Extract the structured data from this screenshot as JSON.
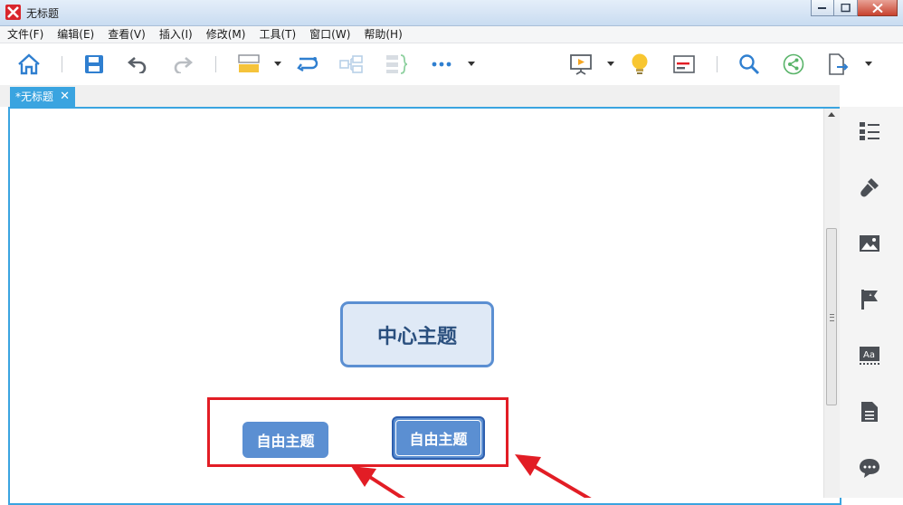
{
  "window": {
    "title": "无标题"
  },
  "menu": [
    {
      "label": "文件(F)"
    },
    {
      "label": "编辑(E)"
    },
    {
      "label": "查看(V)"
    },
    {
      "label": "插入(I)"
    },
    {
      "label": "修改(M)"
    },
    {
      "label": "工具(T)"
    },
    {
      "label": "窗口(W)"
    },
    {
      "label": "帮助(H)"
    }
  ],
  "toolbar": {
    "icons": [
      "home-icon",
      "save-icon",
      "undo-icon",
      "redo-icon",
      "topic-icon",
      "relationship-icon",
      "summary-icon",
      "boundary-icon",
      "more-icon",
      "presentation-icon",
      "idea-icon",
      "outline-icon",
      "search-icon",
      "share-icon",
      "export-icon"
    ]
  },
  "tab": {
    "label": "*无标题",
    "close_glyph": "✕"
  },
  "mindmap": {
    "central_topic": "中心主题",
    "floating_topics": [
      "自由主题",
      "自由主题"
    ]
  },
  "sidebar": {
    "icons": [
      "outline-panel-icon",
      "format-brush-icon",
      "image-icon",
      "marker-flag-icon",
      "text-style-icon",
      "notes-icon",
      "comment-icon"
    ]
  },
  "colors": {
    "accent": "#3aa4e0",
    "topic_fill": "#5b8fd2",
    "central_fill": "#dfe9f6",
    "annotation_red": "#e21d25"
  }
}
